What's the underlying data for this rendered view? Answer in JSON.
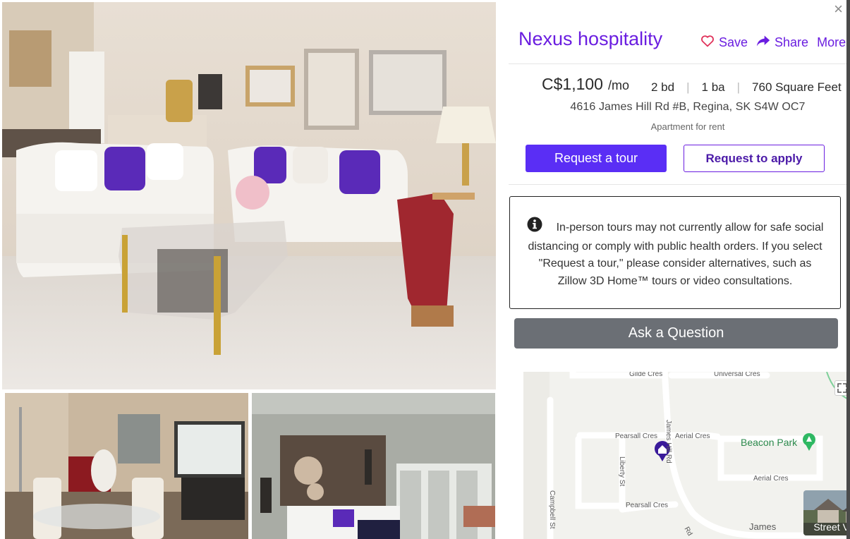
{
  "listing": {
    "title": "Nexus hospitality",
    "price": "C$1,100",
    "per": "/mo",
    "beds": "2 bd",
    "baths": "1 ba",
    "sqft": "760 Square Feet",
    "address": "4616 James Hill Rd #B, Regina, SK S4W OC7",
    "type": "Apartment for rent"
  },
  "actions": {
    "close_icon": "×",
    "save_label": "Save",
    "share_label": "Share",
    "more_label": "More"
  },
  "buttons": {
    "tour": "Request a tour",
    "apply": "Request to apply",
    "ask": "Ask a Question"
  },
  "notice": {
    "text": "In-person tours may not currently allow for safe social distancing or comply with public health orders. If you select \"Request a tour,\" please consider alternatives, such as Zillow 3D Home™ tours or video consultations."
  },
  "map": {
    "labels": {
      "gilde": "Gilde Cres",
      "universal": "Universal Cres",
      "pearsall_top": "Pearsall Cres",
      "aerial_top": "Aerial Cres",
      "james_hill": "James Hill Rd",
      "liberty": "Liberty St",
      "aerial_bottom": "Aerial Cres",
      "campbell": "Campbell St",
      "pearsall_bottom": "Pearsall Cres",
      "james": "James",
      "rd": "Rd"
    },
    "park": "Beacon Park",
    "street_view": "Street View"
  },
  "colors": {
    "accent": "#6a1de0",
    "primary_button": "#5a2ef5",
    "ask_button": "#6b6f75",
    "park": "#2d8a4d"
  },
  "icons": {
    "close": "close-icon",
    "save": "heart-icon",
    "share": "share-icon",
    "info": "info-icon",
    "home_pin": "home-pin-icon",
    "park_pin": "tree-pin-icon",
    "expand": "expand-icon"
  }
}
